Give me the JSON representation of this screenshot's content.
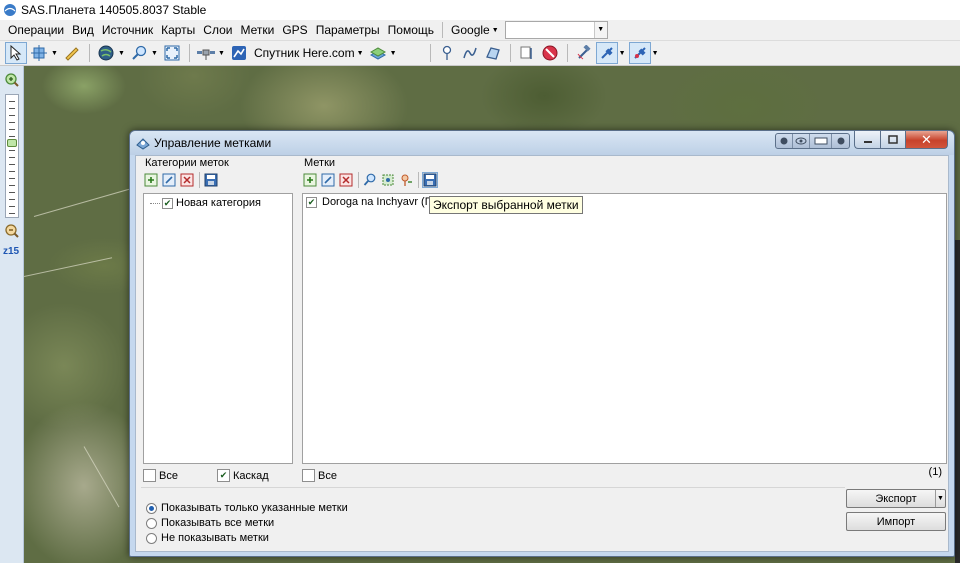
{
  "window": {
    "title": "SAS.Планета 140505.8037 Stable"
  },
  "menu": {
    "items": [
      "Операции",
      "Вид",
      "Источник",
      "Карты",
      "Слои",
      "Метки",
      "GPS",
      "Параметры",
      "Помощь"
    ],
    "google_label": "Google",
    "search_value": ""
  },
  "toolbar": {
    "map_source_label": "Спутник Here.com"
  },
  "zoom": {
    "level_label": "z15"
  },
  "dialog": {
    "title": "Управление метками",
    "categories_label": "Категории меток",
    "marks_label": "Метки",
    "category_item": "Новая категория",
    "mark_item": "Doroga na Inchyavr (Путь)",
    "tooltip": "Экспорт выбранной метки",
    "all_left_label": "Все",
    "cascade_label": "Каскад",
    "all_right_label": "Все",
    "count_label": "(1)",
    "radio_options": [
      "Показывать только указанные метки",
      "Показывать все метки",
      "Не показывать метки"
    ],
    "selected_radio": 0,
    "export_button": "Экспорт",
    "import_button": "Импорт"
  },
  "colors": {
    "dialog_frame": "#c5d8ee",
    "close_button": "#c7422b",
    "tooltip_bg": "#ffffe1"
  }
}
